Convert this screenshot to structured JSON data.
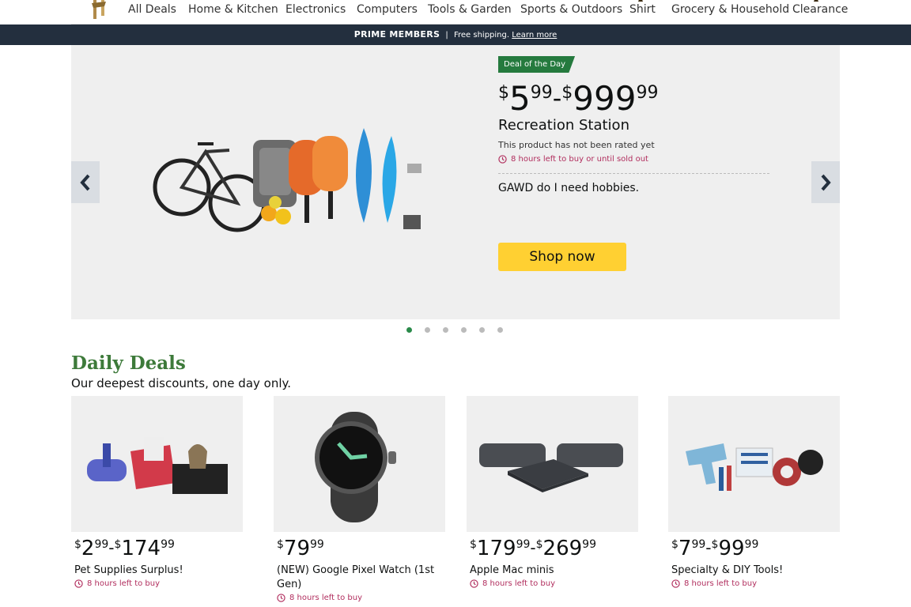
{
  "nav": {
    "items": [
      "All Deals",
      "Home & Kitchen",
      "Electronics",
      "Computers",
      "Tools & Garden",
      "Sports & Outdoors",
      "Shirt",
      "Grocery & Household",
      "Clearance"
    ]
  },
  "prime_banner": {
    "label": "PRIME MEMBERS",
    "separator": "|",
    "text": "Free shipping.",
    "link": "Learn more"
  },
  "hero": {
    "badge": "Deal of the Day",
    "price_low": {
      "sym": "$",
      "whole": "5",
      "frac": "99"
    },
    "price_dash": "-",
    "price_high": {
      "sym": "$",
      "whole": "999",
      "frac": "99"
    },
    "title": "Recreation Station",
    "rating": "This product has not been rated yet",
    "time_left": "8 hours left to buy or until sold out",
    "description": "GAWD do I need hobbies.",
    "cta": "Shop now",
    "carousel_dots": 6,
    "active_dot": 1
  },
  "daily_deals": {
    "title": "Daily Deals",
    "subtitle": "Our deepest discounts, one day only.",
    "cards": [
      {
        "low": {
          "sym": "$",
          "whole": "2",
          "frac": "99"
        },
        "dash": "-",
        "high": {
          "sym": "$",
          "whole": "174",
          "frac": "99"
        },
        "name": "Pet Supplies Surplus!",
        "time": "8 hours left to buy"
      },
      {
        "low": {
          "sym": "$",
          "whole": "79",
          "frac": "99"
        },
        "dash": "",
        "high": {
          "sym": "",
          "whole": "",
          "frac": ""
        },
        "name": "(NEW) Google Pixel Watch (1st Gen)",
        "time": "8 hours left to buy"
      },
      {
        "low": {
          "sym": "$",
          "whole": "179",
          "frac": "99"
        },
        "dash": "-",
        "high": {
          "sym": "$",
          "whole": "269",
          "frac": "99"
        },
        "name": "Apple Mac minis",
        "time": "8 hours left to buy"
      },
      {
        "low": {
          "sym": "$",
          "whole": "7",
          "frac": "99"
        },
        "dash": "-",
        "high": {
          "sym": "$",
          "whole": "99",
          "frac": "99"
        },
        "name": "Specialty & DIY Tools!",
        "time": "8 hours left to buy"
      }
    ]
  },
  "colors": {
    "prime_bg": "#232f3e",
    "badge_green": "#257a3e",
    "deals_green": "#3d7a3a",
    "cta_yellow": "#ffd032",
    "time_red": "#b12e5e"
  }
}
